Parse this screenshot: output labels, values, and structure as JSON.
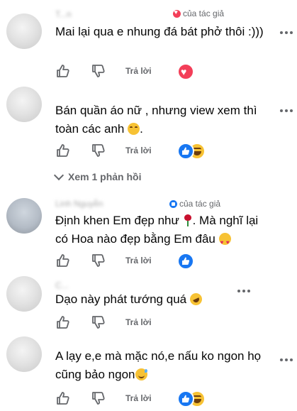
{
  "author_badge": "của tác giả",
  "reply_label": "Trả lời",
  "view_replies": "Xem 1 phản hồi",
  "comments": [
    {
      "author": "T...n",
      "text": "Mai lại qua e nhung đá bát phở thôi :)))"
    },
    {
      "author": "",
      "text_a": "Bán quần áo nữ , nhưng view xem thì toàn các anh"
    },
    {
      "author": "Linh Nguyễn",
      "text_a": "Định khen Em đẹp như",
      "text_b": ". Mà nghĩ lại có Hoa nào đẹp bằng Em đâu"
    },
    {
      "author": "C...",
      "text_a": "Dạo này phát tướng quá"
    },
    {
      "author": "",
      "text_a": "A lạy e,e mà mặc nó,e nấu ko ngon họ cũng bảo ngon"
    }
  ],
  "colors": {
    "like_blue": "#1877f2",
    "love_red": "#f33e58",
    "meta_gray": "#65676b",
    "text": "#050505"
  },
  "icons": [
    "heart-icon",
    "like-icon",
    "dislike-icon",
    "more-icon",
    "chevron-down-icon"
  ]
}
